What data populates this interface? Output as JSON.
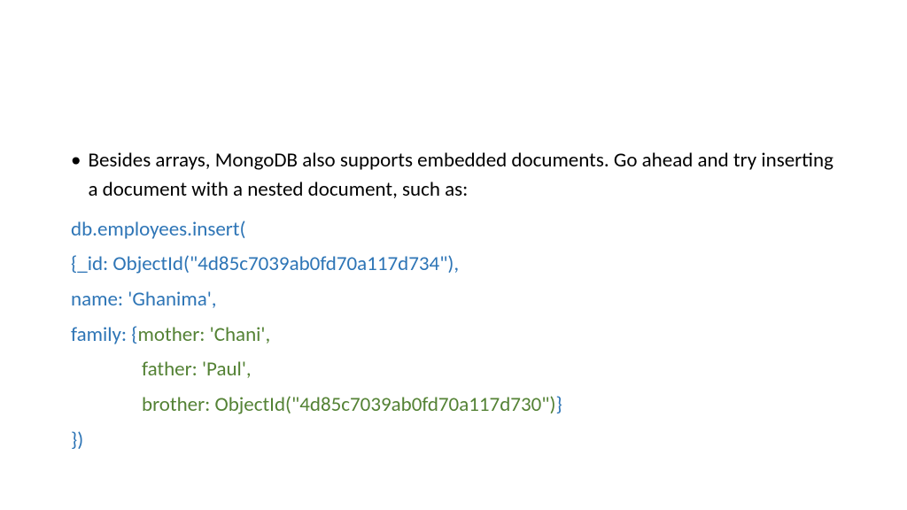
{
  "bullet": {
    "symbol": "•",
    "text": "Besides arrays, MongoDB also supports embedded documents. Go ahead and try inserting a document with a nested document, such as:"
  },
  "code": {
    "line1": "db.employees.insert(",
    "line2": "{_id: ObjectId(\"4d85c7039ab0fd70a117d734\"),",
    "line3": "name: 'Ghanima',",
    "line4_blue": "family: {",
    "line4_green": "mother: 'Chani',",
    "line5": "father: 'Paul',",
    "line6_green": "brother: ObjectId(\"4d85c7039ab0fd70a117d730\")",
    "line6_blue": "}",
    "line7": "})"
  }
}
